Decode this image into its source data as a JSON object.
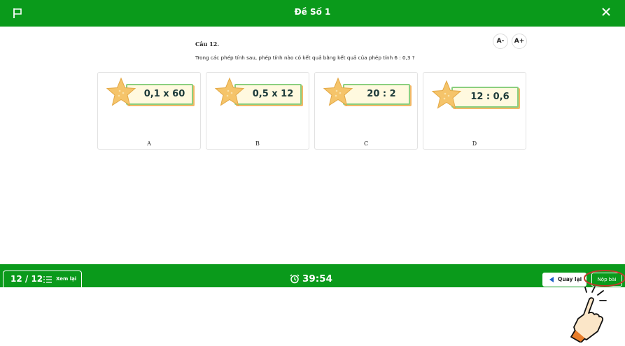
{
  "header": {
    "title": "Đề Số 1",
    "flag_icon": "flag-icon",
    "close_icon": "close-icon"
  },
  "font_controls": {
    "decrease": "A-",
    "increase": "A+"
  },
  "question": {
    "label": "Câu 12.",
    "text": "Trong các phép tính sau, phép tính nào có kết quả bằng kết quả của phép tính 6 : 0,3 ?"
  },
  "options": [
    {
      "letter": "A",
      "expression": "0,1 x 60"
    },
    {
      "letter": "B",
      "expression": "0,5 x 12"
    },
    {
      "letter": "C",
      "expression": "20 : 2"
    },
    {
      "letter": "D",
      "expression": "12 : 0,6"
    }
  ],
  "footer": {
    "progress": "12 / 12",
    "review_label": "Xem lại",
    "timer": "39:54",
    "back_label": "Quay lại",
    "submit_label": "Nộp bài"
  },
  "colors": {
    "brand_green": "#0a9a1b",
    "badge_fill": "#fff9df",
    "badge_border": "#8bcf7f",
    "star": "#f5c46a",
    "highlight": "#c0392b"
  }
}
